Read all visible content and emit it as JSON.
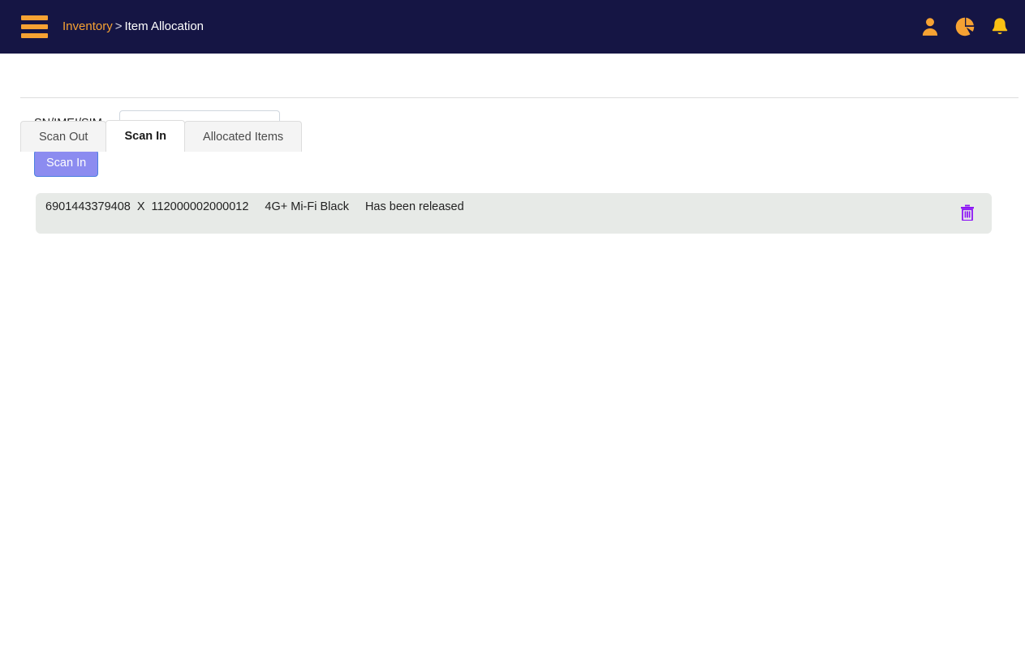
{
  "header": {
    "menu_icon": "hamburger-menu-icon",
    "breadcrumb": {
      "root": "Inventory",
      "separator": ">",
      "current": "Item Allocation"
    },
    "icons": [
      {
        "name": "user-profile-icon",
        "label": "Profile"
      },
      {
        "name": "pie-chart-icon",
        "label": "Reports"
      },
      {
        "name": "bell-notification-icon",
        "label": "Notifications"
      }
    ],
    "colors": {
      "background": "#151544",
      "accent": "#f6a233",
      "text": "#ffffff"
    }
  },
  "tabs": [
    {
      "label": "Scan Out",
      "active": false
    },
    {
      "label": "Scan In",
      "active": true
    },
    {
      "label": "Allocated Items",
      "active": false
    }
  ],
  "form": {
    "field_label": "SN/IMEI/SIM",
    "field_value": "",
    "field_placeholder": "",
    "submit_label": "Scan In",
    "submit_color": "#8c8cf0"
  },
  "results": [
    {
      "barcode": "6901443379408",
      "marker": "X",
      "serial": "112000002000012",
      "product": "4G+ Mi-Fi Black",
      "status": "Has been released",
      "delete_icon": "trash-delete-icon",
      "delete_color": "#8c16f5"
    }
  ]
}
